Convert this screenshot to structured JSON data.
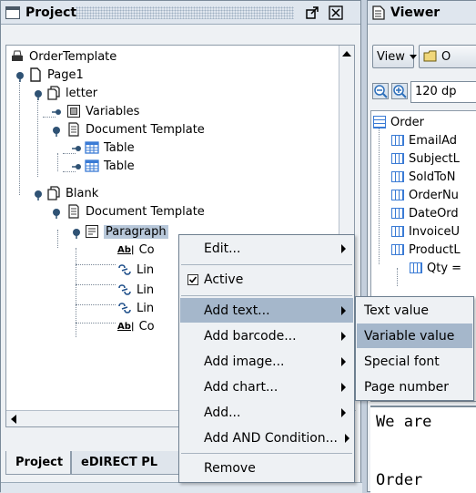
{
  "project_panel": {
    "title": "Project",
    "tree": {
      "root": "OrderTemplate",
      "page": "Page1",
      "letter": "letter",
      "variables": "Variables",
      "doc_template_1": "Document Template",
      "table_1": "Table",
      "table_2": "Table",
      "blank": "Blank",
      "doc_template_2": "Document Template",
      "paragraph": "Paragraph",
      "child_1": "Co",
      "child_2": "Lin",
      "child_3": "Lin",
      "child_4": "Lin",
      "child_5": "Co"
    },
    "tabs": [
      "Project",
      "eDIRECT PL"
    ]
  },
  "viewer_panel": {
    "title": "Viewer",
    "view_button": "View",
    "open_button_partial": "O",
    "zoom_value": "120 dp",
    "tree": [
      "Order",
      "EmailAd",
      "SubjectL",
      "SoldToN",
      "OrderNu",
      "DateOrd",
      "InvoiceU",
      "ProductL",
      "Qty ="
    ],
    "preview_lines": [
      "We are",
      "Order"
    ]
  },
  "context_menu": {
    "items": [
      {
        "label": "Edit...",
        "submenu": true
      },
      {
        "label": "Active",
        "checked": true
      },
      {
        "label": "Add text...",
        "submenu": true,
        "highlighted": true
      },
      {
        "label": "Add barcode...",
        "submenu": true
      },
      {
        "label": "Add image...",
        "submenu": true
      },
      {
        "label": "Add chart...",
        "submenu": true
      },
      {
        "label": "Add...",
        "submenu": true
      },
      {
        "label": "Add AND Condition...",
        "submenu": true
      },
      {
        "label": "Remove",
        "submenu": false
      }
    ]
  },
  "submenu": {
    "items": [
      "Text value",
      "Variable value",
      "Special font",
      "Page number"
    ],
    "highlighted": "Variable value"
  },
  "colors": {
    "highlight": "#a5b7cb",
    "selection": "#b8c8da",
    "titlebar": "#dfe6ee"
  }
}
